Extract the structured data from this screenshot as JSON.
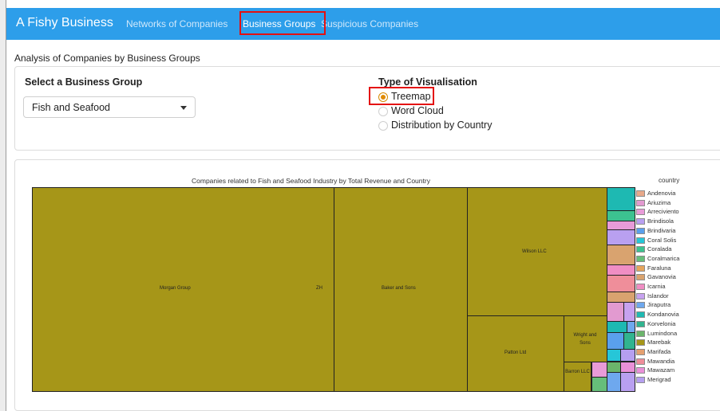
{
  "navbar": {
    "brand": "A Fishy Business",
    "links": [
      {
        "label": "Networks of Companies"
      },
      {
        "label": "Business Groups"
      },
      {
        "label": "Suspicious Companies"
      }
    ]
  },
  "page": {
    "title": "Analysis of Companies by Business Groups"
  },
  "controls": {
    "group_label": "Select a Business Group",
    "group_value": "Fish and Seafood",
    "vis_label": "Type of Visualisation",
    "options": [
      {
        "label": "Treemap",
        "checked": true
      },
      {
        "label": "Word Cloud",
        "checked": false
      },
      {
        "label": "Distribution by Country",
        "checked": false
      }
    ]
  },
  "chart": {
    "title": "Companies related to Fish and Seafood Industry by Total Revenue and Country",
    "legend_title": "country",
    "colors": {
      "main": "#a69618"
    },
    "rects": [
      {
        "label": "Morgan Group",
        "extra": "ZH"
      },
      {
        "label": "Baker and Sons"
      },
      {
        "label": "Wilson LLC"
      },
      {
        "label": "Patton Ltd"
      },
      {
        "label": "Wright and Sons"
      },
      {
        "label": "Barron LLC"
      }
    ],
    "legend": [
      {
        "name": "Andenovia",
        "color": "#e8a98a"
      },
      {
        "name": "Ariuzima",
        "color": "#e29ad0"
      },
      {
        "name": "Arreciviento",
        "color": "#e89bd8"
      },
      {
        "name": "Brindisola",
        "color": "#b9a0f0"
      },
      {
        "name": "Brindivaria",
        "color": "#5aa0ec"
      },
      {
        "name": "Coral Solis",
        "color": "#26c6d8"
      },
      {
        "name": "Coralada",
        "color": "#3cc290"
      },
      {
        "name": "Coralmarica",
        "color": "#66be7a"
      },
      {
        "name": "Faraluna",
        "color": "#e6a55c"
      },
      {
        "name": "Gavanovia",
        "color": "#d9a36f"
      },
      {
        "name": "Icarnia",
        "color": "#f08ec4"
      },
      {
        "name": "Islandor",
        "color": "#c7a2f0"
      },
      {
        "name": "Jiraputra",
        "color": "#6ea8ee"
      },
      {
        "name": "Kondanovia",
        "color": "#1eb9b2"
      },
      {
        "name": "Korvelonia",
        "color": "#31b48f"
      },
      {
        "name": "Lumindona",
        "color": "#6bb56b"
      },
      {
        "name": "Marebak",
        "color": "#a69618"
      },
      {
        "name": "Marifada",
        "color": "#e4a070"
      },
      {
        "name": "Mawandia",
        "color": "#ef8e9a"
      },
      {
        "name": "Mawazam",
        "color": "#ea90d8"
      },
      {
        "name": "Merigrad",
        "color": "#b59ff0"
      }
    ]
  }
}
